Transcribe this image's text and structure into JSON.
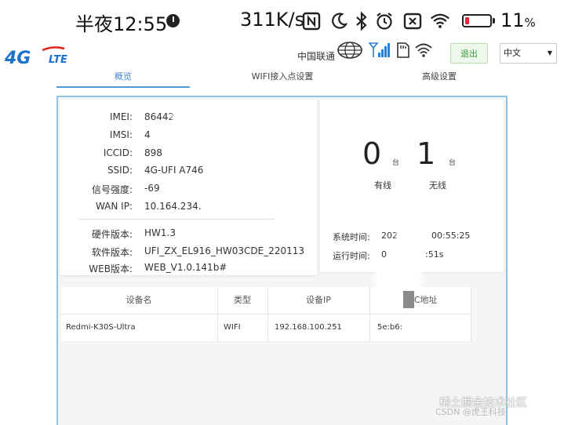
{
  "status_bar": {
    "time": "半夜12:55",
    "net_speed": "311K/s",
    "battery_value": "11",
    "battery_unit": "%",
    "icons": [
      "alarm-clock-icon",
      "nfc-icon",
      "moon-icon",
      "bluetooth-icon",
      "alarm-icon",
      "data-off-icon",
      "wifi-icon",
      "battery-icon"
    ]
  },
  "header": {
    "logo_text_4g": "4G",
    "logo_text_lte": "LTE",
    "carrier": "中国联通",
    "logout_label": "退出",
    "language_selected": "中文",
    "icons": [
      "globe-icon",
      "signal-icon",
      "sim-card-icon",
      "wifi-icon"
    ]
  },
  "tabs": [
    {
      "label": "概览",
      "active": true
    },
    {
      "label": "WIFI接入点设置",
      "active": false
    },
    {
      "label": "高级设置",
      "active": false
    }
  ],
  "device_info": [
    {
      "label": "IMEI:",
      "value": "86442"
    },
    {
      "label": "IMSI:",
      "value": "4"
    },
    {
      "label": "ICCID:",
      "value": "898"
    },
    {
      "label": "SSID:",
      "value": "4G-UFI A746"
    },
    {
      "label": "信号强度:",
      "value": "-69"
    },
    {
      "label": "WAN IP:",
      "value": "10.164.234."
    }
  ],
  "version_info": [
    {
      "label": "硬件版本:",
      "value": "HW1.3"
    },
    {
      "label": "软件版本:",
      "value": "UFI_ZX_EL916_HW03CDE_220113"
    },
    {
      "label": "WEB版本:",
      "value": "WEB_V1.0.141b#"
    }
  ],
  "connections": {
    "wired_count": "0",
    "wired_unit": "台",
    "wired_label": "有线",
    "wireless_count": "1",
    "wireless_unit": "台",
    "wireless_label": "无线"
  },
  "times": {
    "system_label": "系统时间:",
    "system_value_a": "202",
    "system_value_b": "00:55:25",
    "uptime_label": "运行时间:",
    "uptime_value_a": "0",
    "uptime_value_b": ":51s"
  },
  "device_table": {
    "headers": [
      "设备名",
      "类型",
      "设备IP",
      "AC地址"
    ],
    "rows": [
      {
        "name": "Redmi-K30S-Ultra",
        "type": "WIFI",
        "ip": "192.168.100.251",
        "mac": "5e:b6:"
      }
    ]
  },
  "watermark": {
    "line1": "稀土掘金技术社区",
    "line2": "CSDN @虎王科技"
  }
}
